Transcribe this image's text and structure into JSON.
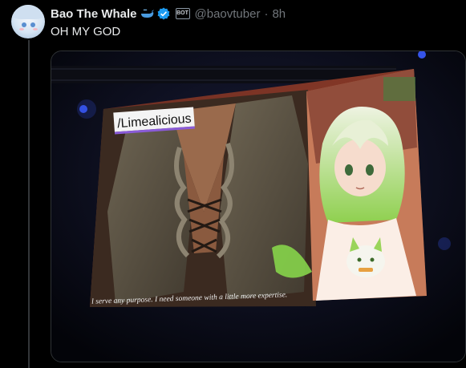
{
  "tweet": {
    "author_name": "Bao The Whale",
    "handle": "@baovtuber",
    "separator": "·",
    "time": "8h",
    "text": "OH MY GOD",
    "bot_badge": "BOT"
  },
  "media": {
    "screen_label": "/Limealicious",
    "subtitle": "l serve any purpose. I need someone with a little more expertise."
  },
  "colors": {
    "verified": "#1d9bf0",
    "whale": "#4a9be0",
    "muted": "#71767b"
  }
}
